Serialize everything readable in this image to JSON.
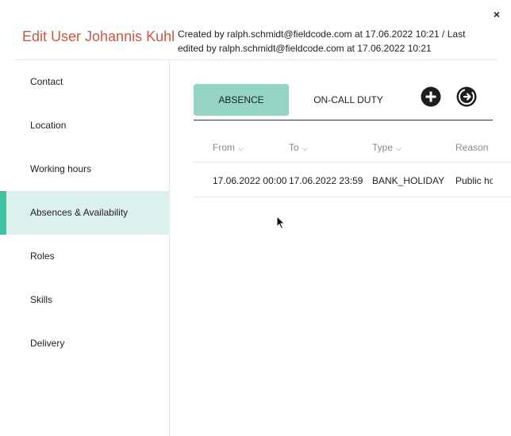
{
  "dialog": {
    "title": "Edit User Johannis Kuhl",
    "meta": "Created by ralph.schmidt@fieldcode.com at 17.06.2022 10:21 / Last edited by ralph.schmidt@fieldcode.com at 17.06.2022 10:21",
    "close_label": "×"
  },
  "sidebar": {
    "items": [
      {
        "label": "Contact",
        "active": false
      },
      {
        "label": "Location",
        "active": false
      },
      {
        "label": "Working hours",
        "active": false
      },
      {
        "label": "Absences & Availability",
        "active": true
      },
      {
        "label": "Roles",
        "active": false
      },
      {
        "label": "Skills",
        "active": false
      },
      {
        "label": "Delivery",
        "active": false
      }
    ]
  },
  "tabs": [
    {
      "label": "ABSENCE",
      "active": true
    },
    {
      "label": "ON-CALL DUTY",
      "active": false
    }
  ],
  "table": {
    "columns": [
      "From",
      "To",
      "Type",
      "Reason"
    ],
    "rows": [
      {
        "from": "17.06.2022 00:00",
        "to": "17.06.2022 23:59",
        "type": "BANK_HOLIDAY",
        "reason": "Public holiday"
      }
    ]
  },
  "colors": {
    "title": "#c9574a",
    "active_tab": "#93d4c5",
    "active_nav_bg": "#dcf1ee",
    "active_nav_bar": "#3ec3a0"
  }
}
